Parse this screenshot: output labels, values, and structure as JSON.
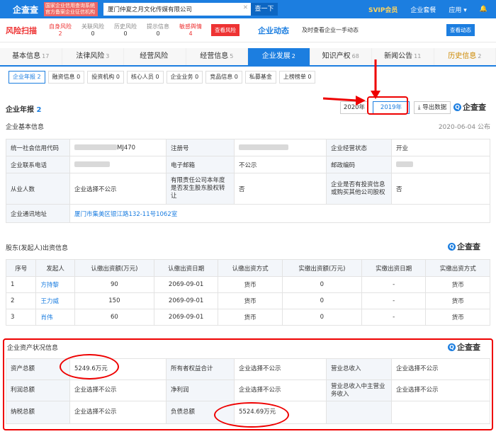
{
  "topbar": {
    "logo": "企查查",
    "tagline1": "国家企业信用查询系统",
    "tagline2": "官方备案企业征信机构",
    "search_value": "厦门仲夏之月文化传媒有限公司",
    "search_btn": "查一下",
    "svip": "SVIP会员",
    "link1": "企业套餐",
    "link2": "应用 ▾"
  },
  "risk": {
    "logo": "风险扫描",
    "items": [
      {
        "label": "自身风险",
        "count": "2"
      },
      {
        "label": "关联风险",
        "count": "0"
      },
      {
        "label": "历史风险",
        "count": "0"
      },
      {
        "label": "提示信息",
        "count": "0"
      },
      {
        "label": "敏感舆情",
        "count": "4"
      }
    ],
    "btn": "查看风险",
    "dyn_logo": "企业动态",
    "dyn_text": "及时查看企业一手动态",
    "dyn_btn": "查看动态"
  },
  "tabs": [
    {
      "label": "基本信息",
      "count": "17"
    },
    {
      "label": "法律风险",
      "count": "3"
    },
    {
      "label": "经营风险",
      "count": ""
    },
    {
      "label": "经营信息",
      "count": "5"
    },
    {
      "label": "企业发展",
      "count": "2"
    },
    {
      "label": "知识产权",
      "count": "68"
    },
    {
      "label": "新闻公告",
      "count": "11"
    },
    {
      "label": "历史信息",
      "count": "2"
    }
  ],
  "subtabs": [
    "企业年报 2",
    "融资信息 0",
    "投资机构 0",
    "核心人员 0",
    "企业业务 0",
    "竞品信息 0",
    "私募基金",
    "上榜榜单 0"
  ],
  "report": {
    "title": "企业年报",
    "count": "2",
    "year1": "2020年",
    "year2": "2019年",
    "export": "导出数据",
    "brand": "企查查",
    "basic_title": "企业基本信息",
    "date": "2020-06-04 公布"
  },
  "basic": [
    [
      "统一社会信用代码",
      "MJ470",
      "注册号",
      "",
      "企业经营状态",
      "开业"
    ],
    [
      "企业联系电话",
      "",
      "电子邮箱",
      "不公示",
      "邮政编码",
      ""
    ],
    [
      "从业人数",
      "企业选择不公示",
      "有限责任公司本年度是否发生股东股权转让",
      "否",
      "企业是否有投资信息或购买其他公司股权",
      "否"
    ],
    [
      "企业通讯地址",
      "厦门市集美区银江路132-11号1062室",
      "",
      "",
      "",
      ""
    ]
  ],
  "shareholder": {
    "title": "股东(发起人)出资信息",
    "headers": [
      "序号",
      "发起人",
      "认缴出资额(万元)",
      "认缴出资日期",
      "认缴出资方式",
      "实缴出资额(万元)",
      "实缴出资日期",
      "实缴出资方式"
    ],
    "rows": [
      [
        "1",
        "方持黎",
        "90",
        "2069-09-01",
        "货币",
        "0",
        "-",
        "货币"
      ],
      [
        "2",
        "王力威",
        "150",
        "2069-09-01",
        "货币",
        "0",
        "-",
        "货币"
      ],
      [
        "3",
        "肖伟",
        "60",
        "2069-09-01",
        "货币",
        "0",
        "-",
        "货币"
      ]
    ]
  },
  "assets": {
    "title": "企业资产状况信息",
    "rows": [
      [
        "资产总额",
        "5249.6万元",
        "所有者权益合计",
        "企业选择不公示",
        "营业总收入",
        "企业选择不公示"
      ],
      [
        "利润总额",
        "企业选择不公示",
        "净利润",
        "企业选择不公示",
        "营业总收入中主营业务收入",
        "企业选择不公示"
      ],
      [
        "纳税总额",
        "企业选择不公示",
        "负债总额",
        "5524.69万元",
        "",
        ""
      ]
    ]
  }
}
